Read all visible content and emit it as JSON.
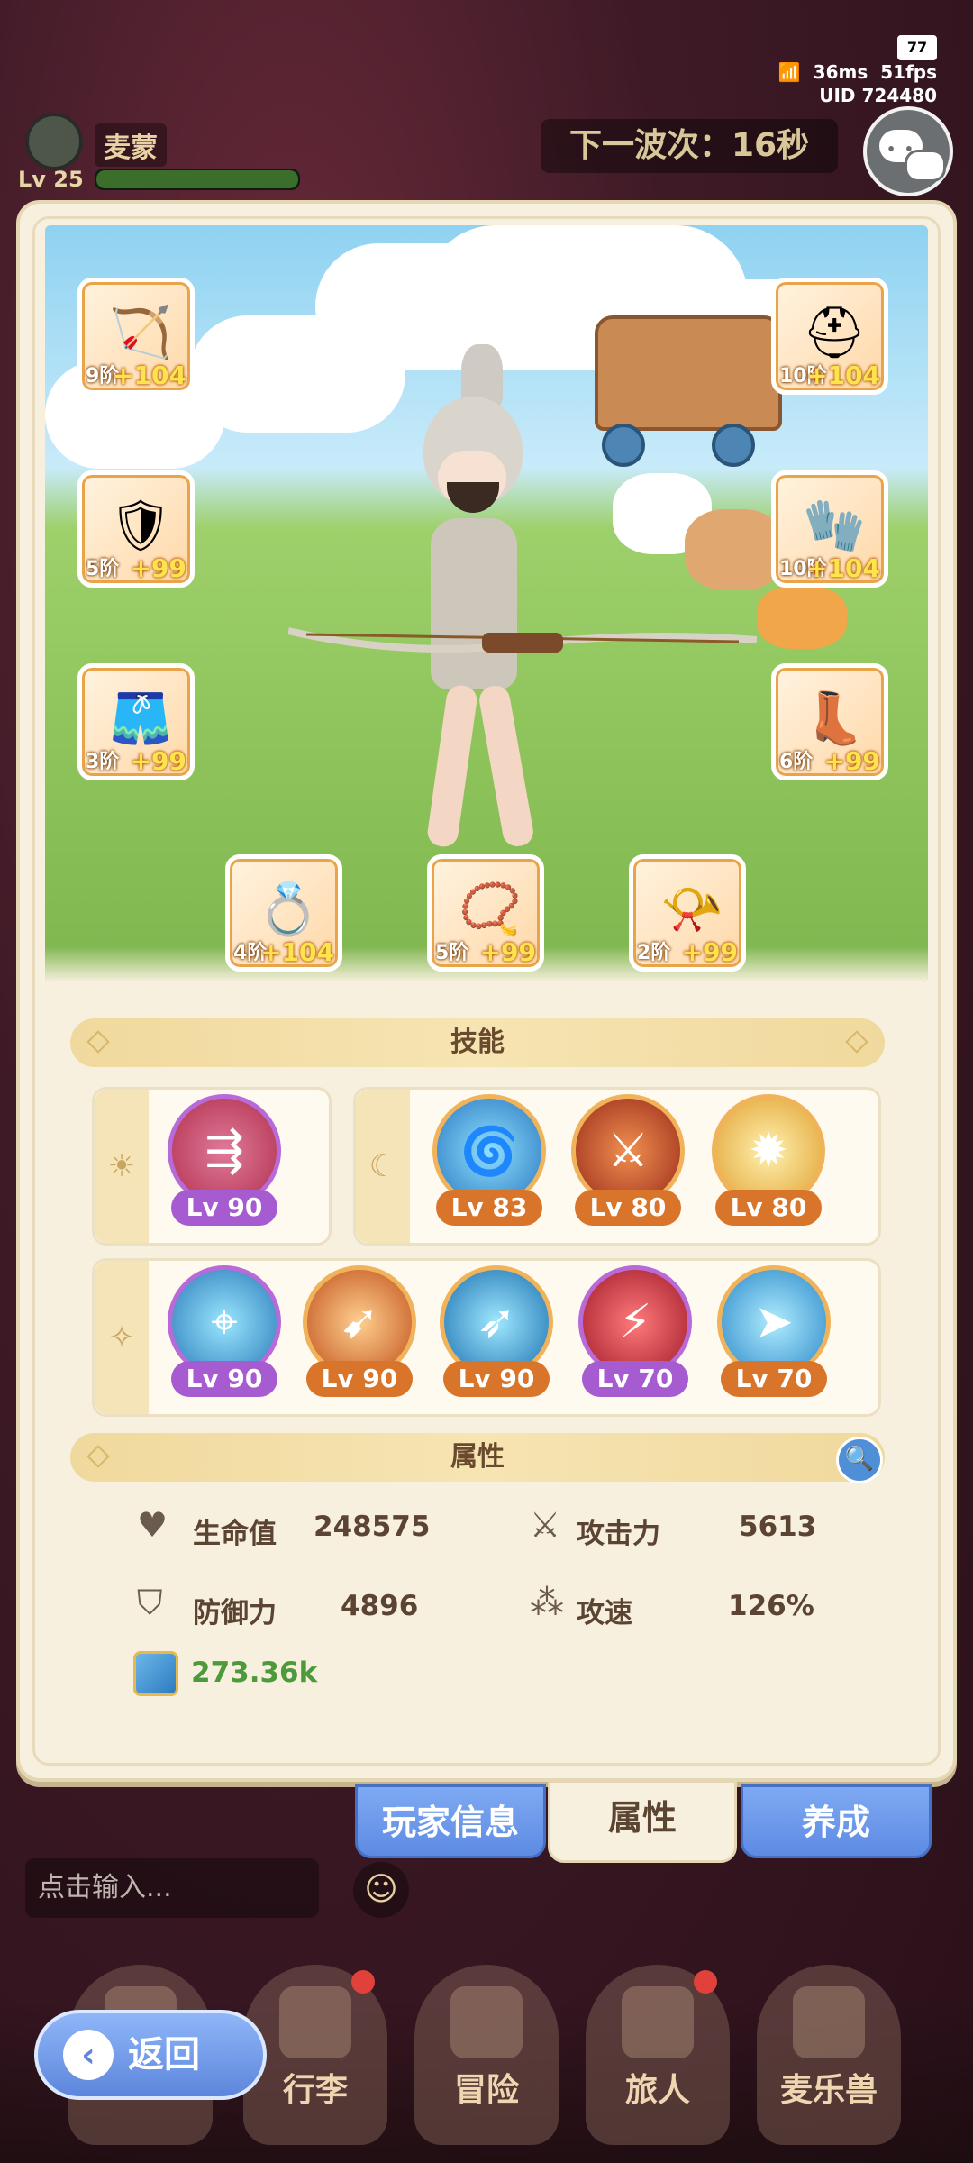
{
  "status_bar": {
    "battery": "77",
    "ping": "36ms",
    "fps": "51fps",
    "uid": "UID 724480"
  },
  "player": {
    "name": "麦蒙",
    "level": "Lv 25"
  },
  "wave": {
    "text": "下一波次：16秒"
  },
  "equipment": [
    {
      "slot": "weapon",
      "icon": "bow-icon",
      "tier": "9阶",
      "bonus": "+104"
    },
    {
      "slot": "helmet",
      "icon": "helmet-icon",
      "tier": "10阶",
      "bonus": "+104"
    },
    {
      "slot": "chest",
      "icon": "chest-armor-icon",
      "tier": "5阶",
      "bonus": "+99"
    },
    {
      "slot": "gloves",
      "icon": "gloves-icon",
      "tier": "10阶",
      "bonus": "+104"
    },
    {
      "slot": "legs",
      "icon": "leg-armor-icon",
      "tier": "3阶",
      "bonus": "+99"
    },
    {
      "slot": "boots",
      "icon": "boots-icon",
      "tier": "6阶",
      "bonus": "+99"
    },
    {
      "slot": "ring",
      "icon": "ring-icon",
      "tier": "4阶",
      "bonus": "+104"
    },
    {
      "slot": "necklace",
      "icon": "necklace-icon",
      "tier": "5阶",
      "bonus": "+99"
    },
    {
      "slot": "relic",
      "icon": "horn-icon",
      "tier": "2阶",
      "bonus": "+99"
    }
  ],
  "skills_header": "技能",
  "skills": {
    "sun": [
      {
        "level": "Lv 90",
        "color": "purple"
      }
    ],
    "moon": [
      {
        "level": "Lv 83",
        "color": "orange"
      },
      {
        "level": "Lv 80",
        "color": "orange"
      },
      {
        "level": "Lv 80",
        "color": "orange"
      }
    ],
    "star": [
      {
        "level": "Lv 90",
        "color": "purple"
      },
      {
        "level": "Lv 90",
        "color": "orange"
      },
      {
        "level": "Lv 90",
        "color": "orange"
      },
      {
        "level": "Lv 70",
        "color": "purple"
      },
      {
        "level": "Lv 70",
        "color": "orange"
      }
    ]
  },
  "attributes_header": "属性",
  "attributes": {
    "hp_label": "生命值",
    "hp_value": "248575",
    "atk_label": "攻击力",
    "atk_value": "5613",
    "def_label": "防御力",
    "def_value": "4896",
    "spd_label": "攻速",
    "spd_value": "126%",
    "power": "273.36k"
  },
  "tabs": {
    "player_info": "玩家信息",
    "attributes": "属性",
    "cultivate": "养成"
  },
  "chat_input": {
    "placeholder": "点击输入..."
  },
  "nav": {
    "bag": "行李",
    "adventure": "冒险",
    "traveler": "旅人",
    "pet": "麦乐兽"
  },
  "back": {
    "label": "返回"
  },
  "colors": {
    "accent_blue": "#5d86dc",
    "panel": "#f8f0de",
    "power_green": "#4c9a3a",
    "lv_purple": "#a65bd1",
    "lv_orange": "#d9752a"
  }
}
